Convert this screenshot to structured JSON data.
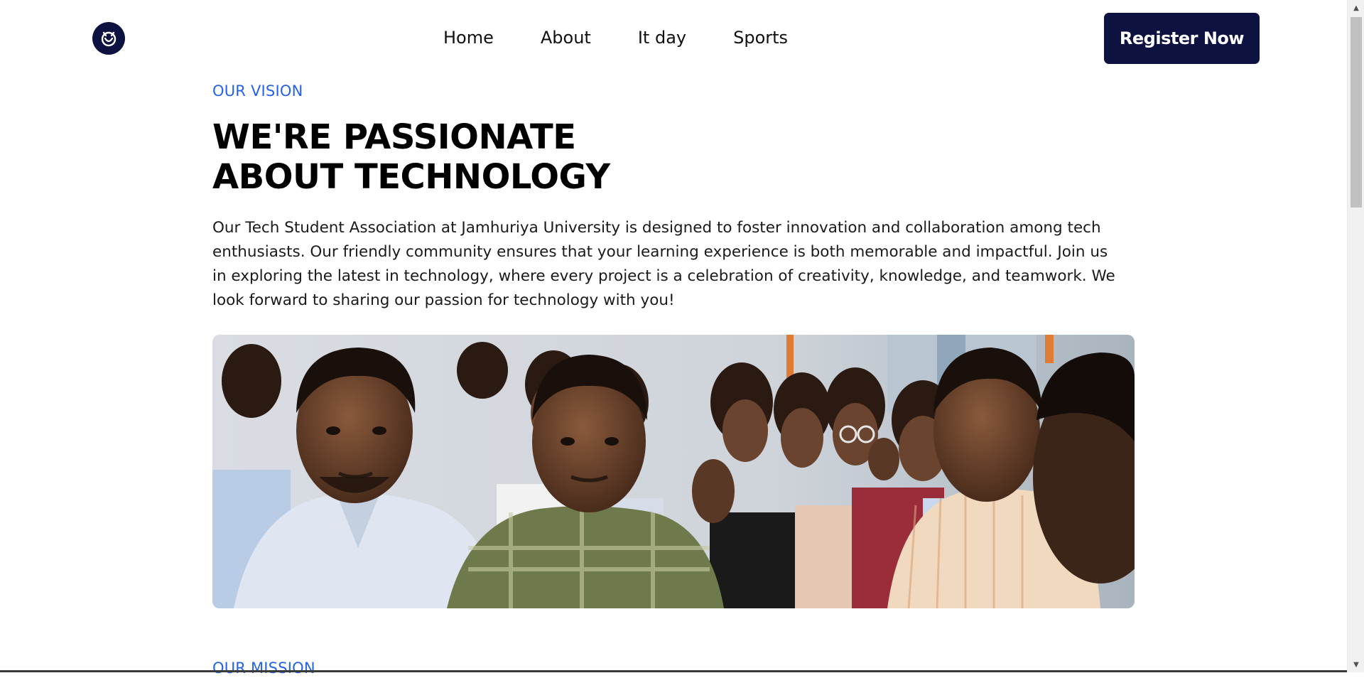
{
  "header": {
    "logo_icon": "owl-logo-icon",
    "nav": [
      {
        "label": "Home"
      },
      {
        "label": "About"
      },
      {
        "label": "It day"
      },
      {
        "label": "Sports"
      }
    ],
    "register_label": "Register Now"
  },
  "vision": {
    "eyebrow": "OUR VISION",
    "headline_line1": "WE'RE PASSIONATE",
    "headline_line2": "ABOUT TECHNOLOGY",
    "body": "Our Tech Student Association at Jamhuriya University is designed to foster innovation and collaboration among tech enthusiasts. Our friendly community ensures that your learning experience is both memorable and impactful. Join us in exploring the latest in technology, where every project is a celebration of creativity, knowledge, and teamwork. We look forward to sharing our passion for technology with you!"
  },
  "mission": {
    "eyebrow": "OUR MISSION"
  },
  "colors": {
    "brand_navy": "#0e1240",
    "accent_blue": "#2563eb",
    "text": "#111111"
  }
}
